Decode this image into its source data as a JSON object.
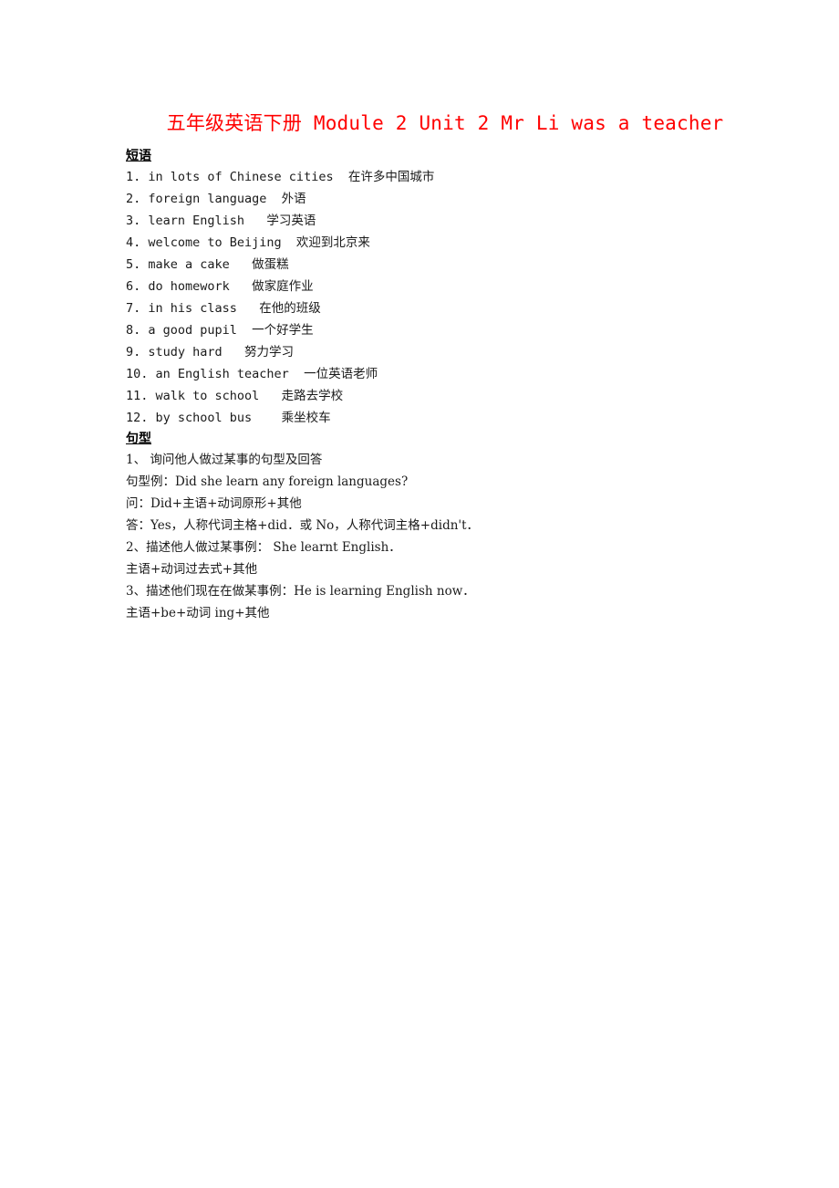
{
  "document": {
    "title": "五年级英语下册 Module 2 Unit 2 Mr Li was a teacher",
    "title_color": "#ff0000"
  },
  "phrases_section": {
    "heading": "短语",
    "items": [
      "1. in lots of Chinese cities  在许多中国城市",
      "2. foreign language  外语",
      "3. learn English   学习英语",
      "4. welcome to Beijing  欢迎到北京来",
      "5. make a cake   做蛋糕",
      "6. do homework   做家庭作业",
      "7. in his class   在他的班级",
      "8. a good pupil  一个好学生",
      "9. study hard   努力学习",
      "10. an English teacher  一位英语老师",
      "11. walk to school   走路去学校",
      "12. by school bus    乘坐校车"
    ]
  },
  "sentences_section": {
    "heading": "句型",
    "items": [
      "1、 询问他人做过某事的句型及回答",
      "句型例：Did she learn any foreign languages?",
      "问：Did+主语+动词原形+其他",
      "答：Yes，人称代词主格+did．或 No，人称代词主格+didn't．",
      "2、描述他人做过某事例： She learnt English．",
      "主语+动词过去式+其他",
      "3、描述他们现在在做某事例：He is learning English now．",
      "主语+be+动词 ing+其他"
    ]
  }
}
